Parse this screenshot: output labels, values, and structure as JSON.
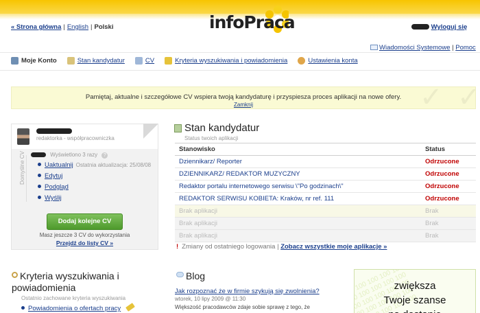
{
  "brand": {
    "logo": "infoPraca"
  },
  "lang": {
    "home": "« Strona główna",
    "sep": "|",
    "english": "English",
    "polish": "Polski"
  },
  "header": {
    "logout": "Wyloguj się"
  },
  "system": {
    "messages": "Wiadomości Systemowe",
    "help": "Pomoc"
  },
  "nav": {
    "items": [
      {
        "label": "Moje Konto",
        "icon": "monitor-icon",
        "color": "#6f8fb3"
      },
      {
        "label": "Stan kandydatur",
        "icon": "document-icon",
        "color": "#d9c37a"
      },
      {
        "label": "CV",
        "icon": "cv-icon",
        "color": "#9fb7d8"
      },
      {
        "label": "Kryteria wyszukiwania i powiadomienia",
        "icon": "pencil-icon",
        "color": "#e6c33a"
      },
      {
        "label": "Ustawienia konta",
        "icon": "settings-icon",
        "color": "#e0a64a"
      }
    ]
  },
  "notice": {
    "text": "Pamiętaj, aktualne i szczegółowe CV wspiera twoją kandydaturę i przyspiesza proces aplikacji na nowe ofery.",
    "hide": "Zamknij"
  },
  "profile": {
    "role": "redaktorka - współpracowniczka",
    "vertical_label": "Domyślne CV",
    "views": "Wyświetlono 3 razy",
    "updated": "Ostatnia aktualizacja: 25/08/08",
    "menu": [
      "Uaktualnij",
      "Edytuj",
      "Podgląd",
      "Wyślij"
    ],
    "add_button": "Dodaj kolejne CV",
    "remaining": "Masz jeszcze 3 CV do wykorzystania",
    "list_link": "Przejdź do listy CV »"
  },
  "status": {
    "title": "Stan kandydatur",
    "subtitle": "Status twoich aplikacji",
    "col_position": "Stanowisko",
    "col_status": "Status",
    "rows": [
      {
        "position": "Dziennikarz/ Reporter",
        "status": "Odrzucone"
      },
      {
        "position": "DZIENNIKARZ/ REDAKTOR MUZYCZNY",
        "status": "Odrzucone"
      },
      {
        "position": "Redaktor portalu internetowego serwisu \\\"Po godzinach\\\"",
        "status": "Odrzucone"
      },
      {
        "position": "REDAKTOR SERWISU KOBIETA: Kraków, nr ref. 111",
        "status": "Odrzucone"
      }
    ],
    "empty_rows": [
      {
        "position": "Brak aplikacji",
        "status": "Brak"
      },
      {
        "position": "Brak aplikacji",
        "status": "Brak"
      },
      {
        "position": "Brak aplikacji",
        "status": "Brak"
      }
    ],
    "changes_text": "Zmiany od ostatniego logowania",
    "changes_sep": "|",
    "all_link": "Zobacz wszystkie moje aplikacje »"
  },
  "criteria": {
    "title": "Kryteria wyszukiwania i powiadomienia",
    "subtitle": "Ostatnio zachowane kryteria wyszukiwania",
    "link": "Powiadomienia o ofertach pracy"
  },
  "blog": {
    "title": "Blog",
    "post_title": "Jak rozpoznać że w firmie szykują się zwolnienia?",
    "post_date": "wtorek, 10 lipy 2009 @ 11:30",
    "post_excerpt": "Większość pracodawców zdaje sobie sprawę z tego, że"
  },
  "ad": {
    "line1": "zwiększa",
    "line2": "Twoje szanse",
    "line3": "na dostanie",
    "bg": "100 100 100 100 100"
  }
}
